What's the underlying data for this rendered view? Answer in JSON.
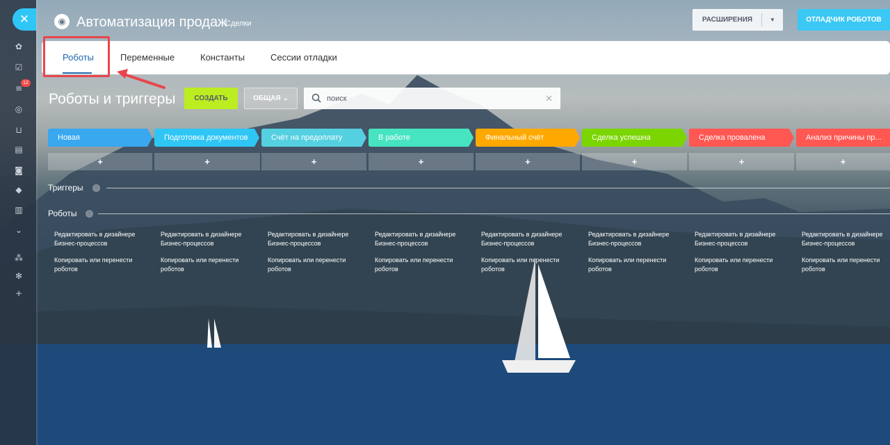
{
  "sidebar": {
    "close_icon": "✕",
    "badge_count": "12",
    "icons": [
      "users-group-icon",
      "checkbox-icon",
      "filter-icon",
      "target-icon",
      "cart-icon",
      "contact-card-icon",
      "robot-icon",
      "box-icon",
      "building-icon",
      "chevron-circle-icon",
      "sitemap-icon",
      "gear-icon",
      "plus-icon"
    ]
  },
  "header": {
    "title": "Автоматизация продаж",
    "subtitle": "Сделки",
    "extensions_label": "РАСШИРЕНИЯ",
    "debugger_label": "ОТЛАДЧИК РОБОТОВ"
  },
  "tabs": [
    {
      "label": "Роботы",
      "active": true
    },
    {
      "label": "Переменные",
      "active": false
    },
    {
      "label": "Константы",
      "active": false
    },
    {
      "label": "Сессии отладки",
      "active": false
    }
  ],
  "toolbar": {
    "section_title": "Роботы и триггеры",
    "create_label": "СОЗДАТЬ",
    "filter_label": "ОБЩАЯ",
    "search_placeholder": "поиск"
  },
  "stages": [
    {
      "label": "Новая",
      "color": "#39a8ef"
    },
    {
      "label": "Подготовка документов",
      "color": "#2fc6f6"
    },
    {
      "label": "Счёт на предоплату",
      "color": "#55d0e0"
    },
    {
      "label": "В работе",
      "color": "#47e4c2"
    },
    {
      "label": "Финальный счёт",
      "color": "#ffa900"
    },
    {
      "label": "Сделка успешна",
      "color": "#7bd500"
    },
    {
      "label": "Сделка провалена",
      "color": "#ff5752"
    },
    {
      "label": "Анализ причины пр...",
      "color": "#ff5752"
    }
  ],
  "add_label": "+",
  "triggers_label": "Триггеры",
  "robots_label": "Роботы",
  "help_label": "?",
  "robot_links": {
    "edit": "Редактировать в дизайнере Бизнес-процессов",
    "copy": "Копировать или перенести роботов"
  }
}
